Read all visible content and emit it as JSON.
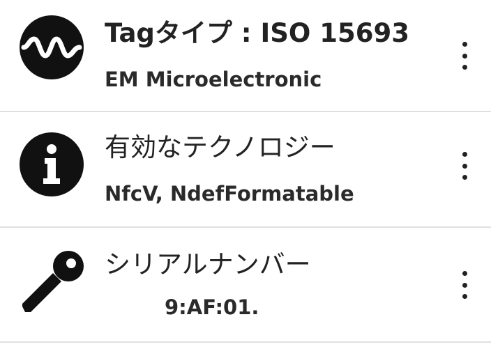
{
  "items": [
    {
      "icon": "waveform-icon",
      "title": "Tagタイプ : ISO 15693",
      "subtitle": "EM Microelectronic"
    },
    {
      "icon": "info-icon",
      "title": "有効なテクノロジー",
      "subtitle": "NfcV, NdefFormatable"
    },
    {
      "icon": "key-icon",
      "title": "シリアルナンバー",
      "subtitle": "9:AF:01."
    }
  ],
  "colors": {
    "icon": "#111111",
    "text": "#222222",
    "divider": "#e0e0e0",
    "background": "#ffffff"
  }
}
